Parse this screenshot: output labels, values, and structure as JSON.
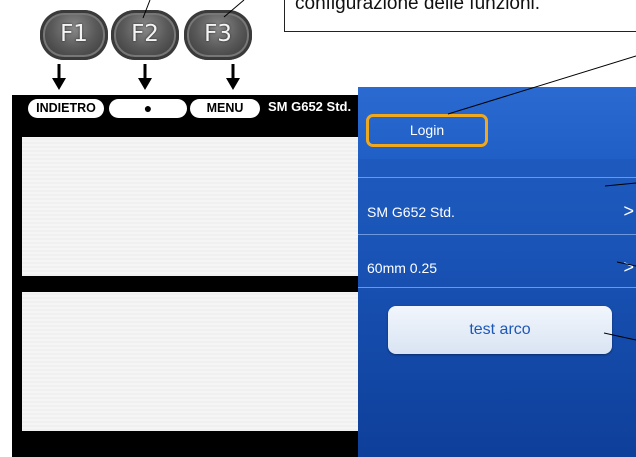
{
  "function_keys": [
    {
      "label": "F1"
    },
    {
      "label": "F2"
    },
    {
      "label": "F3"
    }
  ],
  "callout_text": "configurazione delle funzioni.",
  "splicer_screen": {
    "soft_keys": {
      "back_label": "INDIETRO",
      "center_label": "●",
      "menu_label": "MENU"
    },
    "status_text": "SM G652 Std."
  },
  "menu_panel": {
    "login_label": "Login",
    "rows": [
      {
        "label": "SM G652 Std.",
        "chevron": ">"
      },
      {
        "label": "60mm 0.25",
        "chevron": ">"
      }
    ],
    "test_button_label": "test arco"
  },
  "colors": {
    "panel_blue": "#1a55b8",
    "login_highlight": "#f0a81e",
    "button_text": "#1d58b8"
  }
}
